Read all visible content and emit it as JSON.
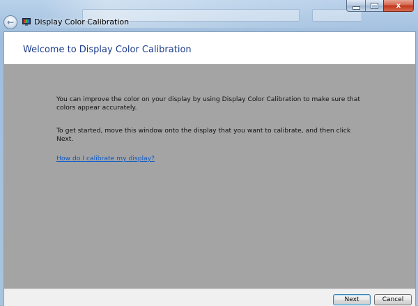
{
  "window": {
    "title": "Display Color Calibration",
    "icons": {
      "back": "back-arrow-icon",
      "app": "display-color-calibration-icon",
      "minimize": "minimize-icon",
      "maximize": "maximize-icon",
      "close": "close-icon"
    },
    "close_glyph": "x",
    "back_glyph": "←"
  },
  "page": {
    "title": "Welcome to Display Color Calibration",
    "paragraph_1": "You can improve the color on your display by using Display Color Calibration to make sure that colors appear accurately.",
    "paragraph_2": "To get started, move this window onto the display that you want to calibrate, and then click Next.",
    "help_link": "How do I calibrate my display?"
  },
  "footer": {
    "next_label": "Next",
    "cancel_label": "Cancel"
  },
  "colors": {
    "content_background": "#a4a4a4",
    "title_color": "#1e3d8f",
    "link_color": "#0a58c8"
  }
}
